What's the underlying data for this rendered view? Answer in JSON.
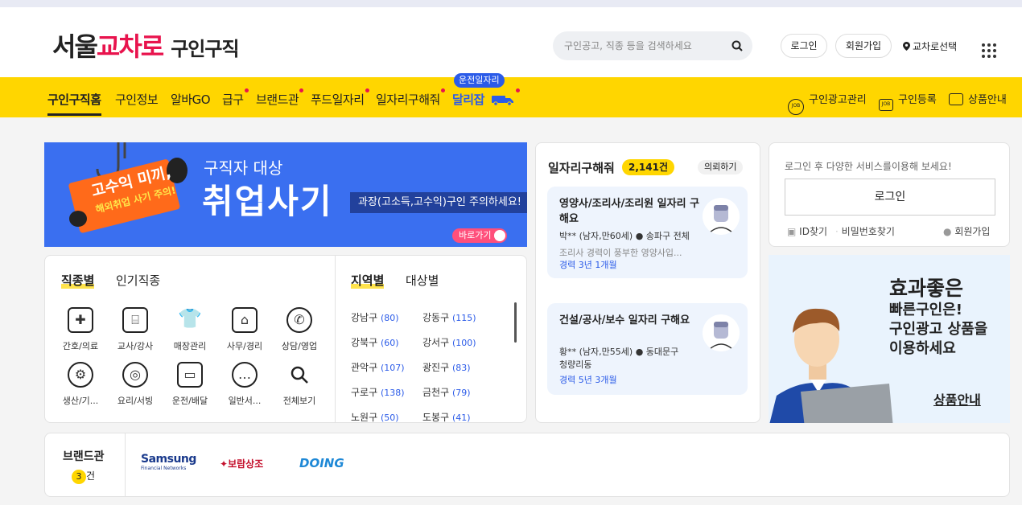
{
  "header": {
    "logo_prefix": "서울",
    "logo_accent": "교차로",
    "logo_sub": "구인구직",
    "search_placeholder": "구인공고, 직종 등을 검색하세요",
    "login_label": "로그인",
    "signup_label": "회원가입",
    "region_label": "교차로선택"
  },
  "nav": {
    "items": [
      "구인구직홈",
      "구인정보",
      "알바GO",
      "급구",
      "브랜드관",
      "푸드일자리",
      "일자리구해줘",
      "달리잡"
    ],
    "badge": "운전일자리",
    "right": [
      "구인광고관리",
      "구인등록",
      "상품안내"
    ]
  },
  "banner": {
    "sign_line1": "고수익 미끼,",
    "sign_line2": "해외취업 사기 주의!",
    "title_small": "구직자 대상",
    "title_big": "취업사기",
    "desc": "과장(고소득,고수익)구인 주의하세요!",
    "cta": "바로가기"
  },
  "categories": {
    "tabs": [
      "직종별",
      "인기직종"
    ],
    "items": [
      "간호/의료",
      "교사/강사",
      "매장관리",
      "사무/경리",
      "상담/영업",
      "생산/기...",
      "요리/서빙",
      "운전/배달",
      "일반서...",
      "전체보기"
    ]
  },
  "regions": {
    "tabs": [
      "지역별",
      "대상별"
    ],
    "items": [
      {
        "name": "강남구",
        "count": "(80)"
      },
      {
        "name": "강동구",
        "count": "(115)"
      },
      {
        "name": "강북구",
        "count": "(60)"
      },
      {
        "name": "강서구",
        "count": "(100)"
      },
      {
        "name": "관악구",
        "count": "(107)"
      },
      {
        "name": "광진구",
        "count": "(83)"
      },
      {
        "name": "구로구",
        "count": "(138)"
      },
      {
        "name": "금천구",
        "count": "(79)"
      },
      {
        "name": "노원구",
        "count": "(50)"
      },
      {
        "name": "도봉구",
        "count": "(41)"
      }
    ]
  },
  "jobs": {
    "title": "일자리구해줘",
    "count": "2,141건",
    "request_label": "의뢰하기",
    "cards": [
      {
        "title": "영양사/조리사/조리원 일자리 구해요",
        "person": "박** (남자,만60세)",
        "location": "송파구 전체",
        "desc": "조리사 경력이 풍부한 영양사입...",
        "exp": "경력 3년 1개월"
      },
      {
        "title": "건설/공사/보수 일자리 구해요",
        "person": "황** (남자,만55세)",
        "location": "동대문구 청량리동",
        "desc": "",
        "exp": "경력 5년 3개월"
      }
    ]
  },
  "login_panel": {
    "message": "로그인 후 다양한 서비스를이용해 보세요!",
    "login_button": "로그인",
    "find_id": "ID찾기",
    "find_pw": "비밀번호찾기",
    "signup": "회원가입"
  },
  "ad": {
    "line1": "효과좋은",
    "line2": "빠른구인은!",
    "line3": "구인광고 상품을",
    "line4": "이용하세요",
    "cta": "상품안내"
  },
  "brands": {
    "title": "브랜드관",
    "count": "3",
    "count_unit": "건",
    "logos": [
      "Samsung",
      "Financial Networks",
      "보람상조",
      "DOING"
    ]
  },
  "colors": {
    "accent": "#e8134d",
    "nav_bg": "#ffd600",
    "blue": "#2b5be8"
  }
}
